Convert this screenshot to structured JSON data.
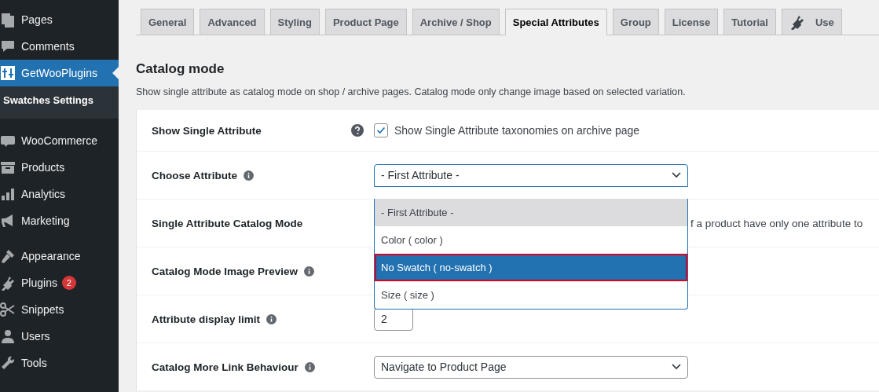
{
  "sidebar": {
    "groups": [
      [
        {
          "label": "Pages",
          "active": false
        },
        {
          "label": "Comments",
          "active": false
        },
        {
          "label": "GetWooPlugins",
          "active": true,
          "submenu": [
            {
              "label": "Swatches Settings",
              "current": true
            }
          ]
        }
      ],
      [
        {
          "label": "WooCommerce",
          "active": false
        },
        {
          "label": "Products",
          "active": false
        },
        {
          "label": "Analytics",
          "active": false
        },
        {
          "label": "Marketing",
          "active": false
        }
      ],
      [
        {
          "label": "Appearance",
          "active": false
        },
        {
          "label": "Plugins",
          "active": false,
          "badge": "2"
        },
        {
          "label": "Snippets",
          "active": false
        },
        {
          "label": "Users",
          "active": false
        },
        {
          "label": "Tools",
          "active": false
        }
      ]
    ]
  },
  "tabs": [
    {
      "label": "General",
      "selected": false
    },
    {
      "label": "Advanced",
      "selected": false
    },
    {
      "label": "Styling",
      "selected": false
    },
    {
      "label": "Product Page",
      "selected": false
    },
    {
      "label": "Archive / Shop",
      "selected": false
    },
    {
      "label": "Special Attributes",
      "selected": true
    },
    {
      "label": "Group",
      "selected": false
    },
    {
      "label": "License",
      "selected": false
    },
    {
      "label": "Tutorial",
      "selected": false
    },
    {
      "label": "Use",
      "selected": false,
      "kind": "icon"
    }
  ],
  "section": {
    "title": "Catalog mode",
    "description": "Show single attribute as catalog mode on shop / archive pages. Catalog mode only change image based on selected variation."
  },
  "rows": [
    {
      "label": "Show Single Attribute",
      "help_icon": true,
      "kind": "checkbox",
      "checked": true,
      "text": "Show Single Attribute taxonomies on archive page"
    },
    {
      "label": "Choose Attribute",
      "info_icon": true,
      "kind": "select",
      "value": "- First Attribute -",
      "open": true,
      "options": [
        {
          "label": "- First Attribute -",
          "selected": true,
          "highlighted": false
        },
        {
          "label": "Color ( color )",
          "selected": false,
          "highlighted": false
        },
        {
          "label": "No Swatch ( no-swatch )",
          "selected": false,
          "highlighted": true
        },
        {
          "label": "Size ( size )",
          "selected": false,
          "highlighted": false
        }
      ]
    },
    {
      "label": "Single Attribute Catalog Mode",
      "kind": "text",
      "text": "f a product have only one attribute to"
    },
    {
      "label": "Catalog Mode Image Preview",
      "info_icon": true,
      "kind": "none"
    },
    {
      "label": "Attribute display limit",
      "info_icon": true,
      "kind": "number",
      "value": "2"
    },
    {
      "label": "Catalog More Link Behaviour",
      "info_icon": true,
      "kind": "select",
      "value": "Navigate to Product Page",
      "open": false
    }
  ]
}
